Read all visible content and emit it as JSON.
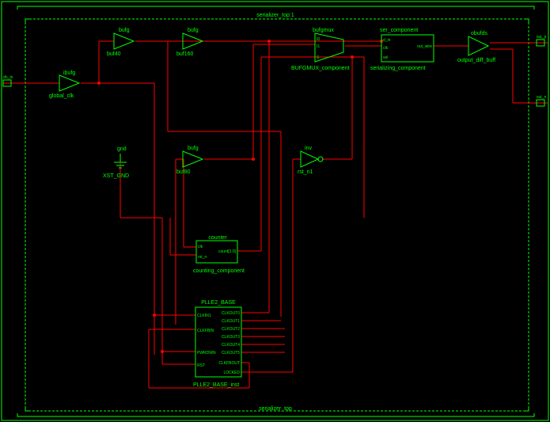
{
  "schematic": {
    "title": "serializer_top:1",
    "footer_label": "serializer_top",
    "components": {
      "ibufg": {
        "type_label": "ibufg",
        "instance_label": "global_clk"
      },
      "buf40": {
        "type_label": "bufg",
        "instance_label": "buf40"
      },
      "buf160": {
        "type_label": "bufg",
        "instance_label": "buf160"
      },
      "buf80": {
        "type_label": "bufg",
        "instance_label": "buf80"
      },
      "bufgmux": {
        "type_label": "bufgmux",
        "instance_label": "BUFGMUX_component"
      },
      "inv": {
        "type_label": "inv",
        "instance_label": "rst_n1"
      },
      "gnd": {
        "type_label": "gnd",
        "instance_label": "XST_GND"
      },
      "ser_component": {
        "type_label": "ser_component",
        "instance_label": "serializing_component"
      },
      "obufds": {
        "type_label": "obufds",
        "instance_label": "output_diff_buff"
      },
      "counter": {
        "type_label": "counter",
        "instance_label": "counting_component"
      },
      "pll": {
        "type_label": "PLLE2_BASE",
        "instance_label": "PLLE2_BASE_inst"
      }
    },
    "input_port": "clk_in",
    "output_ports": {
      "p": "out_p",
      "n": "out_n"
    },
    "pll_pins": {
      "left": [
        "CLKIN1",
        "CLKFBIN",
        "PWRDWN",
        "RST"
      ],
      "right": [
        "CLKOUT0",
        "CLKOUT1",
        "CLKOUT2",
        "CLKOUT3",
        "CLKOUT4",
        "CLKOUT5",
        "CLKFBOUT",
        "LOCKED"
      ]
    },
    "counter_pins": {
      "left": [
        "clk",
        "rst_n"
      ],
      "right": [
        "count[1:0]"
      ]
    },
    "ser_pins": {
      "left": [
        "d_in",
        "clk",
        "sel"
      ],
      "right": [
        "out_wire"
      ]
    },
    "bufgmux_pins": {
      "left": [
        "I0",
        "I1",
        "S"
      ]
    }
  }
}
